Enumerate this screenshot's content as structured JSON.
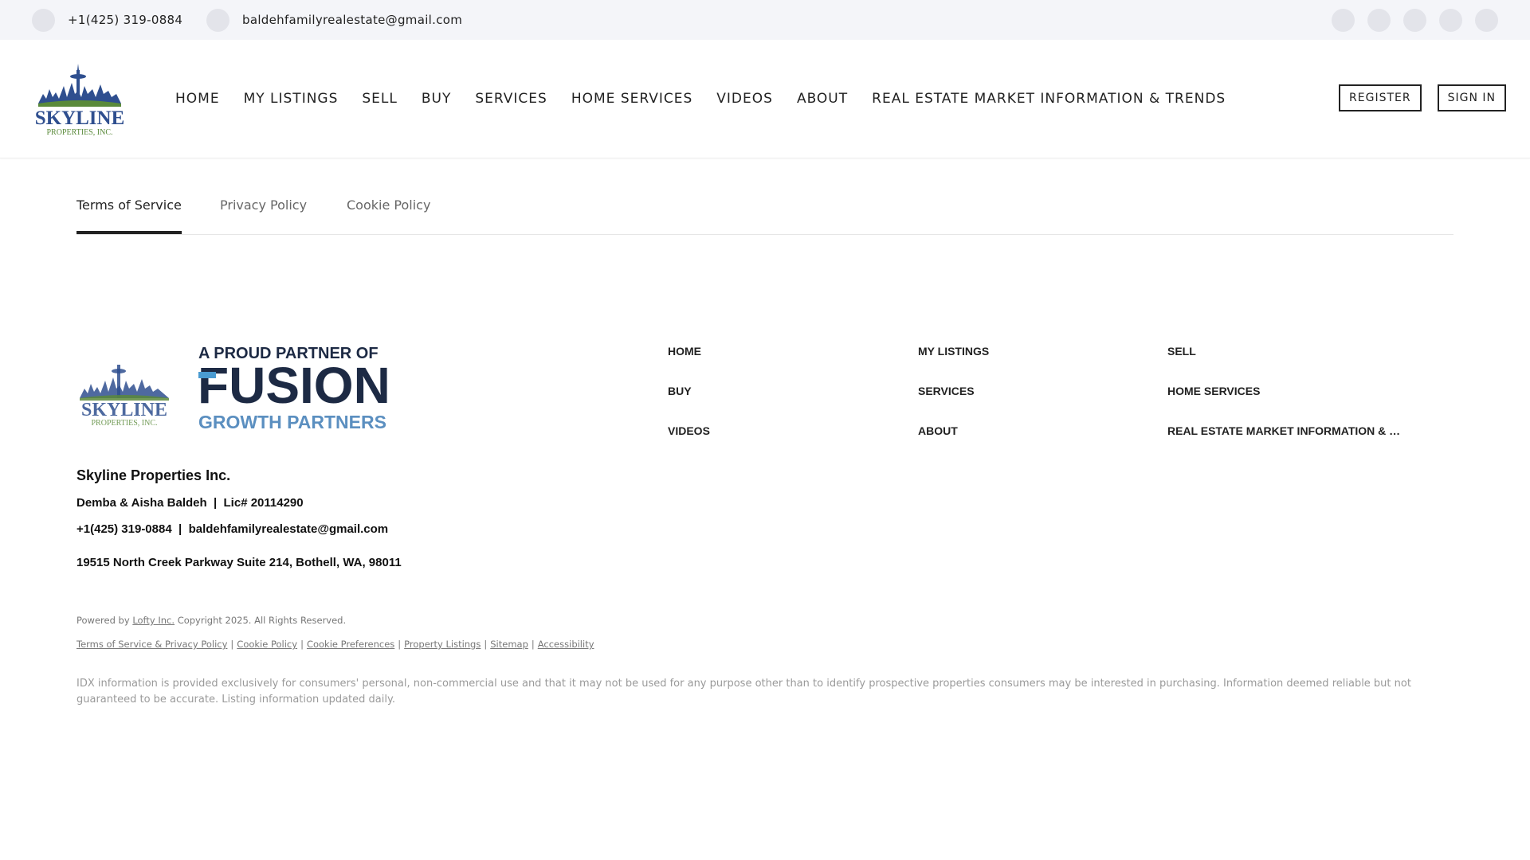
{
  "topbar": {
    "phone": "+1(425) 319-0884",
    "email": "baldehfamilyrealestate@gmail.com",
    "social_icons": [
      "social-icon-1",
      "social-icon-2",
      "social-icon-3",
      "social-icon-4",
      "social-icon-5"
    ]
  },
  "header": {
    "logo_text": "SKYLINE",
    "logo_subtext": "PROPERTIES, INC.",
    "nav": [
      "HOME",
      "MY LISTINGS",
      "SELL",
      "BUY",
      "SERVICES",
      "HOME SERVICES",
      "VIDEOS",
      "ABOUT",
      "REAL ESTATE MARKET INFORMATION & TRENDS"
    ],
    "register_label": "REGISTER",
    "signin_label": "SIGN IN"
  },
  "tabs": {
    "items": [
      "Terms of Service",
      "Privacy Policy",
      "Cookie Policy"
    ],
    "active": "Terms of Service"
  },
  "footer": {
    "logo_text": "SKYLINE",
    "logo_subtext": "PROPERTIES, INC.",
    "partner_line1": "A PROUD PARTNER OF",
    "partner_line2": "FUSION",
    "partner_line3": "GROWTH PARTNERS",
    "nav": [
      "HOME",
      "MY LISTINGS",
      "SELL",
      "BUY",
      "SERVICES",
      "HOME SERVICES",
      "VIDEOS",
      "ABOUT",
      "REAL ESTATE MARKET INFORMATION & …"
    ],
    "company_name": "Skyline Properties Inc.",
    "agents": "Demba & Aisha Baldeh  |  Lic# 20114290",
    "phone": "+1(425) 319-0884",
    "divider": "|",
    "email": "baldehfamilyrealestate@gmail.com",
    "address": "19515 North Creek Parkway Suite 214, Bothell, WA, 98011",
    "powered_prefix": "Powered by",
    "powered_link": "Lofty Inc.",
    "copyright": "Copyright 2025. All Rights Reserved.",
    "legal_links": [
      "Terms of Service & Privacy Policy",
      "Cookie Policy",
      "Cookie Preferences",
      "Property Listings",
      "Sitemap",
      "Accessibility"
    ],
    "disclaimer": "IDX information is provided exclusively for consumers' personal, non-commercial use and that it may not be used for any purpose other than to identify prospective properties consumers may be interested in purchasing. Information deemed reliable but not guaranteed to be accurate. Listing information updated daily."
  },
  "colors": {
    "logo_blue": "#2f4f8f",
    "logo_green": "#5a8a3a",
    "fusion_navy": "#1d2a44",
    "fusion_blue": "#4a9bd1",
    "growth_blue": "#5b8fc0"
  }
}
